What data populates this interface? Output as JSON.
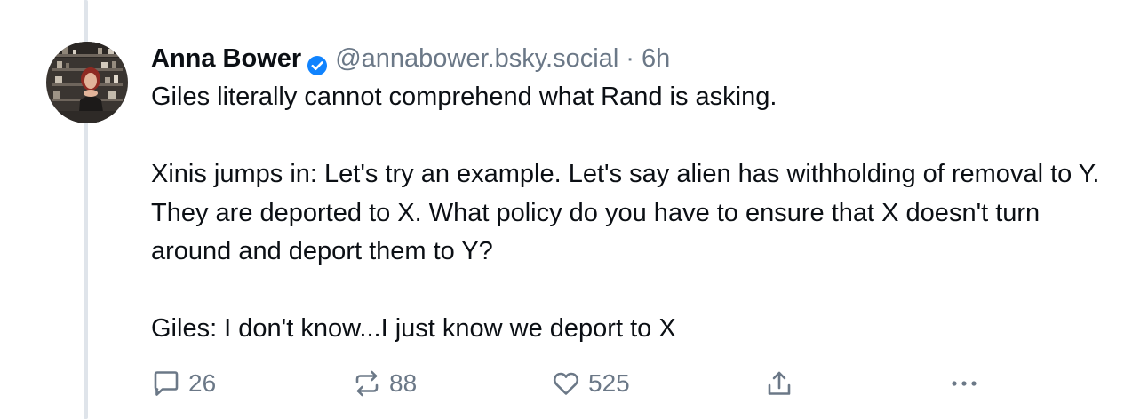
{
  "post": {
    "display_name": "Anna Bower",
    "handle": "@annabower.bsky.social",
    "separator": "·",
    "timestamp": "6h",
    "text": "Giles literally cannot comprehend what Rand is asking.\n\nXinis jumps in: Let's try an example. Let's say alien has withholding of removal to Y. They are deported to X. What policy do you have to ensure that X doesn't turn around and deport them to Y?\n\nGiles: I don't know...I just know we deport to X",
    "verified": true
  },
  "actions": {
    "reply_count": "26",
    "repost_count": "88",
    "like_count": "525"
  },
  "icons": {
    "verified": "verified-badge-icon",
    "reply": "speech-bubble-icon",
    "repost": "repost-arrows-icon",
    "like": "heart-icon",
    "share": "share-upload-icon",
    "more": "more-dots-icon"
  },
  "colors": {
    "text": "#0b0f14",
    "muted": "#6b7887",
    "verified": "#1083fe",
    "thread_line": "#dfe4ea",
    "background": "#ffffff"
  }
}
